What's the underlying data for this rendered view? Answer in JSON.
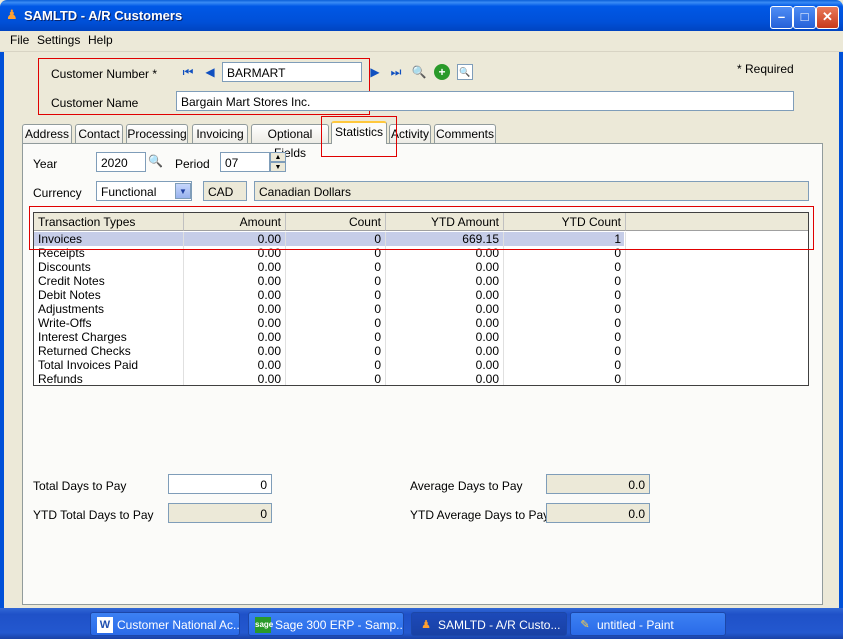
{
  "window": {
    "title": "SAMLTD - A/R Customers"
  },
  "menu": [
    "File",
    "Settings",
    "Help"
  ],
  "header": {
    "customer_number_label": "Customer Number *",
    "customer_number_value": "BARMART",
    "customer_name_label": "Customer Name",
    "customer_name_value": "Bargain Mart Stores Inc.",
    "required_note": "*  Required"
  },
  "tabs": [
    "Address",
    "Contact",
    "Processing",
    "Invoicing",
    "Optional Fields",
    "Statistics",
    "Activity",
    "Comments"
  ],
  "active_tab": "Statistics",
  "stats": {
    "year_label": "Year",
    "year_value": "2020",
    "period_label": "Period",
    "period_value": "07",
    "currency_label": "Currency",
    "currency_value": "Functional",
    "currency_code": "CAD",
    "currency_desc": "Canadian Dollars"
  },
  "grid": {
    "columns": [
      "Transaction Types",
      "Amount",
      "Count",
      "YTD Amount",
      "YTD Count"
    ],
    "rows": [
      [
        "Invoices",
        "0.00",
        "0",
        "669.15",
        "1"
      ],
      [
        "Receipts",
        "0.00",
        "0",
        "0.00",
        "0"
      ],
      [
        "Discounts",
        "0.00",
        "0",
        "0.00",
        "0"
      ],
      [
        "Credit Notes",
        "0.00",
        "0",
        "0.00",
        "0"
      ],
      [
        "Debit Notes",
        "0.00",
        "0",
        "0.00",
        "0"
      ],
      [
        "Adjustments",
        "0.00",
        "0",
        "0.00",
        "0"
      ],
      [
        "Write-Offs",
        "0.00",
        "0",
        "0.00",
        "0"
      ],
      [
        "Interest Charges",
        "0.00",
        "0",
        "0.00",
        "0"
      ],
      [
        "Returned Checks",
        "0.00",
        "0",
        "0.00",
        "0"
      ],
      [
        "Total Invoices Paid",
        "0.00",
        "0",
        "0.00",
        "0"
      ],
      [
        "Refunds",
        "0.00",
        "0",
        "0.00",
        "0"
      ]
    ]
  },
  "days": {
    "total_days_label": "Total Days to Pay",
    "total_days_value": "0",
    "ytd_total_days_label": "YTD Total Days to Pay",
    "ytd_total_days_value": "0",
    "avg_days_label": "Average Days to Pay",
    "avg_days_value": "0.0",
    "ytd_avg_days_label": "YTD Average Days to Pay",
    "ytd_avg_days_value": "0.0"
  },
  "taskbar": [
    {
      "label": "Customer National Ac...",
      "icon": "word-icon"
    },
    {
      "label": "Sage 300 ERP - Samp...",
      "icon": "sage-icon"
    },
    {
      "label": "SAMLTD - A/R Custo...",
      "icon": "customer-icon"
    },
    {
      "label": "untitled - Paint",
      "icon": "paint-icon"
    }
  ]
}
